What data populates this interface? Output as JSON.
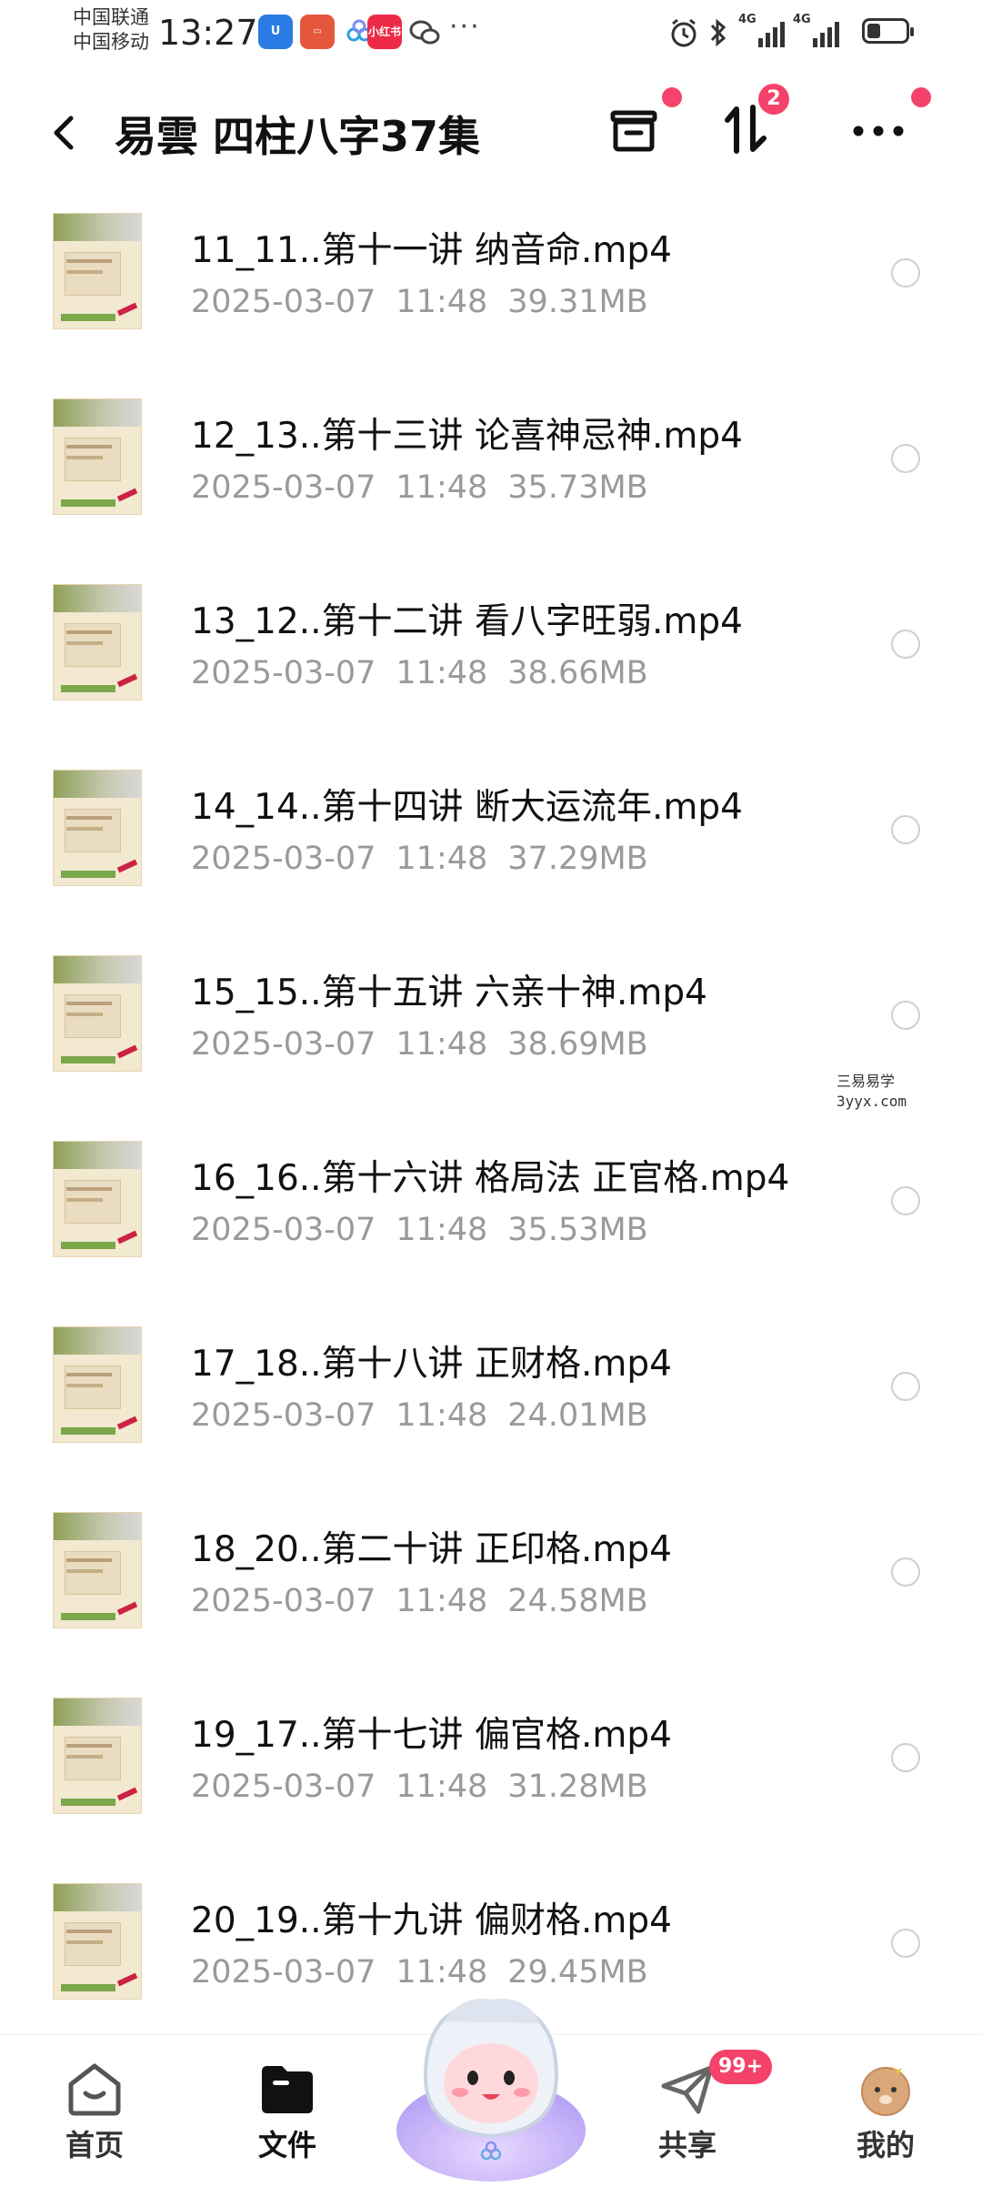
{
  "status_bar": {
    "carrier_1": "中国联通",
    "carrier_2": "中国移动",
    "time": "13:27",
    "red_app_label": "小红书",
    "more": "···",
    "signal_1": "4G",
    "signal_2": "4G"
  },
  "header": {
    "title": "易雲 四柱八字37集",
    "transfer_badge": "2"
  },
  "files": [
    {
      "name": "11_11..第十一讲 纳音命.mp4",
      "date": "2025-03-07",
      "time": "11:48",
      "size": "39.31MB"
    },
    {
      "name": "12_13..第十三讲 论喜神忌神.mp4",
      "date": "2025-03-07",
      "time": "11:48",
      "size": "35.73MB"
    },
    {
      "name": "13_12..第十二讲 看八字旺弱.mp4",
      "date": "2025-03-07",
      "time": "11:48",
      "size": "38.66MB"
    },
    {
      "name": "14_14..第十四讲 断大运流年.mp4",
      "date": "2025-03-07",
      "time": "11:48",
      "size": "37.29MB"
    },
    {
      "name": "15_15..第十五讲 六亲十神.mp4",
      "date": "2025-03-07",
      "time": "11:48",
      "size": "38.69MB"
    },
    {
      "name": "16_16..第十六讲 格局法 正官格.mp4",
      "date": "2025-03-07",
      "time": "11:48",
      "size": "35.53MB"
    },
    {
      "name": "17_18..第十八讲 正财格.mp4",
      "date": "2025-03-07",
      "time": "11:48",
      "size": "24.01MB"
    },
    {
      "name": "18_20..第二十讲 正印格.mp4",
      "date": "2025-03-07",
      "time": "11:48",
      "size": "24.58MB"
    },
    {
      "name": "19_17..第十七讲 偏官格.mp4",
      "date": "2025-03-07",
      "time": "11:48",
      "size": "31.28MB"
    },
    {
      "name": "20_19..第十九讲 偏财格.mp4",
      "date": "2025-03-07",
      "time": "11:48",
      "size": "29.45MB"
    }
  ],
  "watermark": {
    "line1": "三易易学",
    "line2": "3yyx.com"
  },
  "bottom_nav": {
    "home": "首页",
    "files": "文件",
    "share": "共享",
    "share_badge": "99+",
    "mine": "我的"
  },
  "colors": {
    "accent_red": "#f5426a",
    "meta_gray": "#9a9a9a"
  },
  "icons": {
    "back": "chevron-left-icon",
    "box": "archive-icon",
    "sort": "sort-arrows-icon",
    "more": "more-dots-icon"
  }
}
